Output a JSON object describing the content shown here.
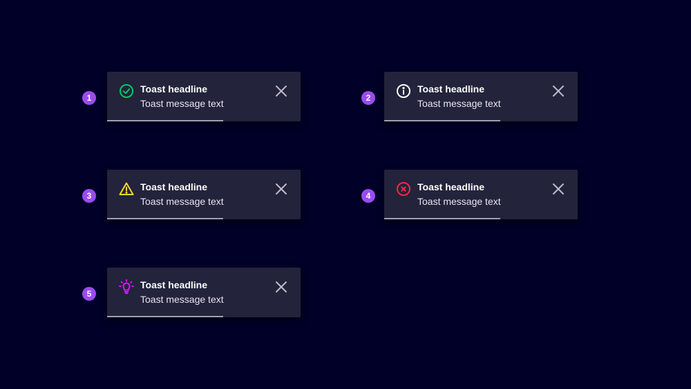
{
  "toasts": [
    {
      "number": "1",
      "type": "success",
      "icon": "check-circle-icon",
      "color": "#00cc66",
      "headline": "Toast headline",
      "message": "Toast message text",
      "progress": 0.6
    },
    {
      "number": "2",
      "type": "info",
      "icon": "info-icon",
      "color": "#ffffff",
      "headline": "Toast headline",
      "message": "Toast message text",
      "progress": 0.6
    },
    {
      "number": "3",
      "type": "warning",
      "icon": "warning-icon",
      "color": "#ffd732",
      "headline": "Toast headline",
      "message": "Toast message text",
      "progress": 0.6
    },
    {
      "number": "4",
      "type": "error",
      "icon": "error-icon",
      "color": "#ff2640",
      "headline": "Toast headline",
      "message": "Toast message text",
      "progress": 0.6
    },
    {
      "number": "5",
      "type": "tip",
      "icon": "lightbulb-icon",
      "color": "#e619ff",
      "headline": "Toast headline",
      "message": "Toast message text",
      "progress": 0.6
    }
  ],
  "colors": {
    "background": "#000028",
    "toast_background": "#23233c",
    "badge": "#9a4cf0",
    "close_icon": "#bdbdcc",
    "progress": "#a0a0b4"
  }
}
